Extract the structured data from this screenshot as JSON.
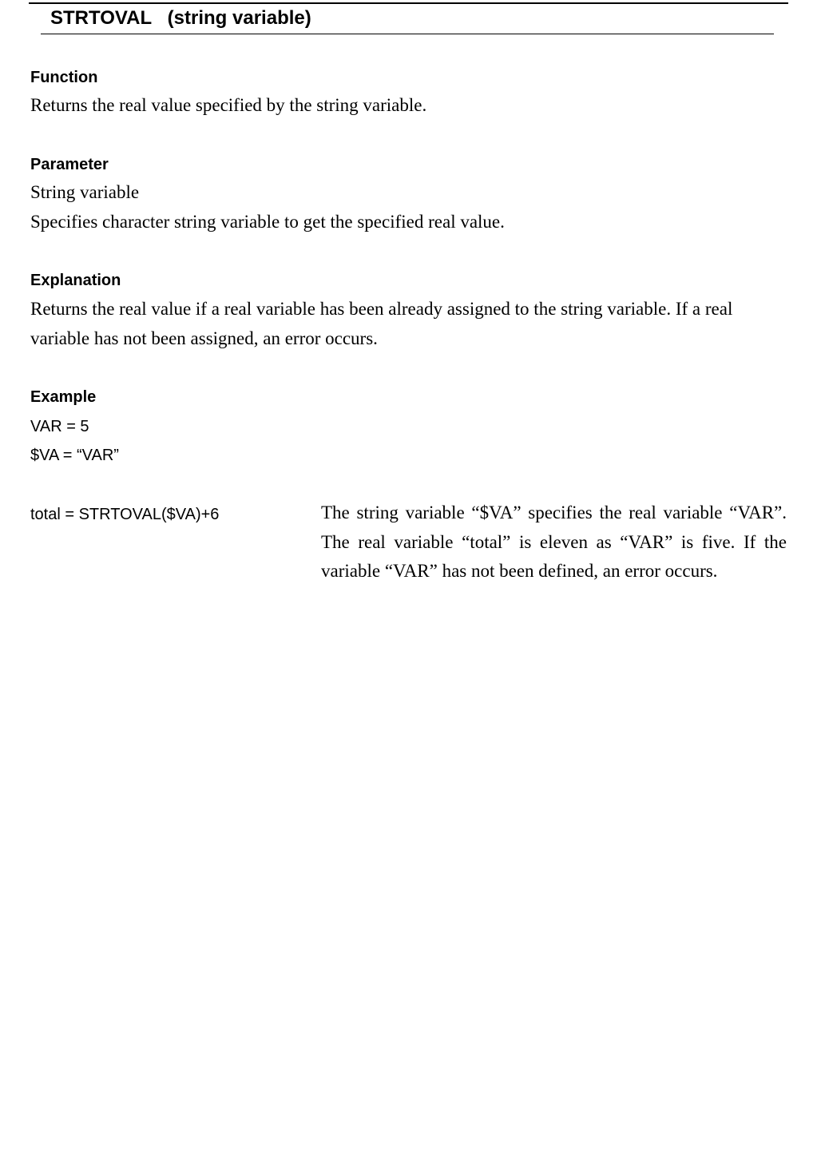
{
  "title": "STRTOVAL   (string variable)",
  "sections": {
    "function": {
      "heading": "Function",
      "text": "Returns the real value specified by the string variable."
    },
    "parameter": {
      "heading": "Parameter",
      "name": "String variable",
      "description": "Specifies character string variable to get the specified real value."
    },
    "explanation": {
      "heading": "Explanation",
      "text": "Returns the real value if a real variable has been already assigned to the string variable.     If a real variable has not been assigned, an error occurs."
    },
    "example": {
      "heading": "Example",
      "code_lines": [
        "VAR = 5",
        "$VA = “VAR”"
      ],
      "statement": "total = STRTOVAL($VA)+6",
      "description": "The string variable “$VA” specifies the real variable “VAR”.    The real variable “total” is eleven as “VAR” is five.    If the variable “VAR” has not been defined, an error occurs."
    }
  }
}
